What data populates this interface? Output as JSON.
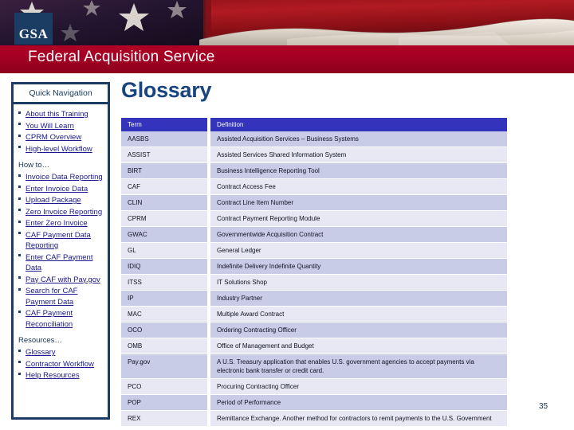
{
  "header": {
    "agency_logo_text": "GSA",
    "title": "Federal Acquisition Service"
  },
  "colors": {
    "banner_red": "#a00022",
    "logo_navy": "#1b3c63",
    "title_navy": "#18457f",
    "table_header_blue": "#3333bb",
    "row_odd": "#c9cce7",
    "row_even": "#e7e8f4",
    "link_blue": "#1a1a8c"
  },
  "sidebar": {
    "title": "Quick Navigation",
    "groups": [
      {
        "label": "",
        "items": [
          {
            "label": "About this Training"
          },
          {
            "label": "You Will Learn"
          },
          {
            "label": "CPRM Overview"
          },
          {
            "label": "High-level Workflow"
          }
        ]
      },
      {
        "label": "How to…",
        "items": [
          {
            "label": "Invoice Data Reporting"
          },
          {
            "label": "Enter Invoice Data"
          },
          {
            "label": "Upload Package"
          },
          {
            "label": "Zero Invoice Reporting"
          },
          {
            "label": "Enter Zero Invoice"
          },
          {
            "label": "CAF Payment Data Reporting"
          },
          {
            "label": "Enter CAF Payment Data"
          },
          {
            "label": "Pay CAF with Pay.gov"
          },
          {
            "label": "Search for CAF Payment Data"
          },
          {
            "label": "CAF Payment Reconciliation"
          }
        ]
      },
      {
        "label": "Resources…",
        "items": [
          {
            "label": "Glossary"
          },
          {
            "label": "Contractor Workflow"
          },
          {
            "label": "Help Resources"
          }
        ]
      }
    ]
  },
  "main": {
    "page_title": "Glossary",
    "table": {
      "columns": [
        "Term",
        "Definition"
      ],
      "rows": [
        {
          "term": "AASBS",
          "definition": "Assisted Acquisition Services – Business Systems"
        },
        {
          "term": "ASSIST",
          "definition": "Assisted Services Shared Information System"
        },
        {
          "term": "BIRT",
          "definition": "Business Intelligence Reporting Tool"
        },
        {
          "term": "CAF",
          "definition": "Contract Access Fee"
        },
        {
          "term": "CLIN",
          "definition": "Contract Line Item Number"
        },
        {
          "term": "CPRM",
          "definition": "Contract Payment Reporting Module"
        },
        {
          "term": "GWAC",
          "definition": "Governmentwide Acquisition Contract"
        },
        {
          "term": "GL",
          "definition": "General Ledger"
        },
        {
          "term": "IDIQ",
          "definition": "Indefinite Delivery Indefinite Quantity"
        },
        {
          "term": "ITSS",
          "definition": "IT Solutions Shop"
        },
        {
          "term": "IP",
          "definition": "Industry Partner"
        },
        {
          "term": "MAC",
          "definition": "Multiple Award Contract"
        },
        {
          "term": "OCO",
          "definition": "Ordering Contracting Officer"
        },
        {
          "term": "OMB",
          "definition": "Office of Management and Budget"
        },
        {
          "term": "Pay.gov",
          "definition": "A U.S. Treasury application that enables U.S. government agencies to accept payments via electronic bank transfer or credit card."
        },
        {
          "term": "PCO",
          "definition": "Procuring Contracting Officer"
        },
        {
          "term": "POP",
          "definition": "Period of Performance"
        },
        {
          "term": "REX",
          "definition": "Remittance Exchange. Another method for contractors to remit payments to the U.S. Government"
        }
      ]
    }
  },
  "footer": {
    "page_number": "35"
  }
}
